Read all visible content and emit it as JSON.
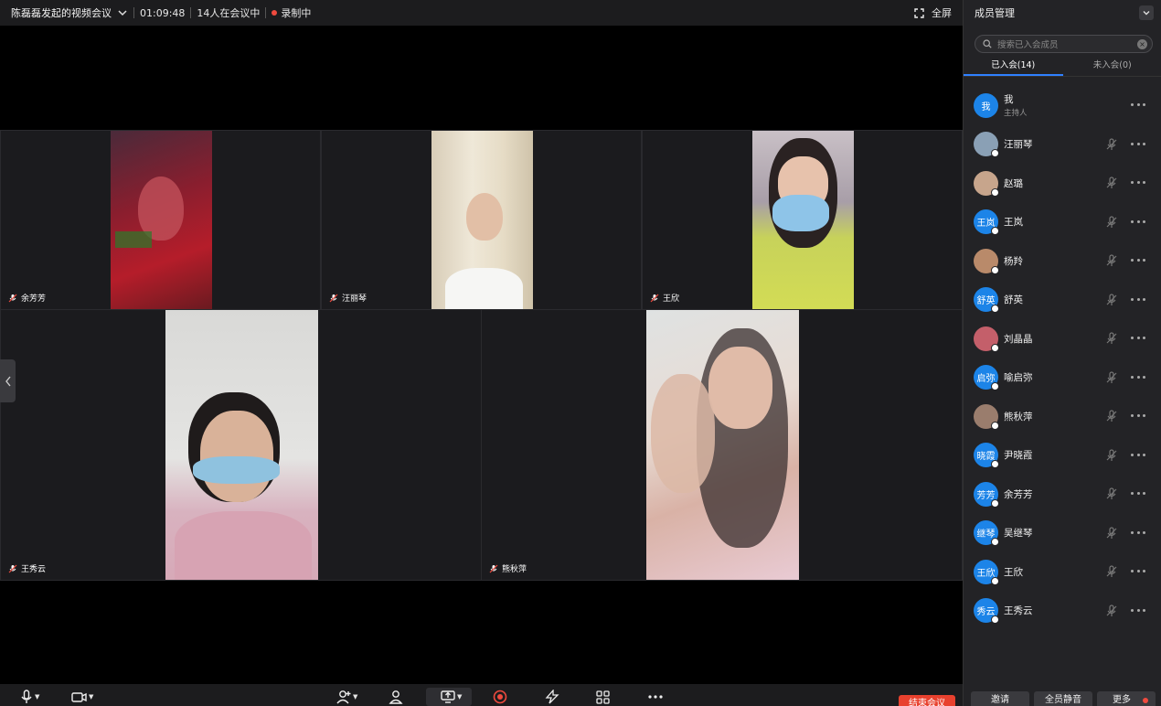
{
  "topbar": {
    "meeting_title": "陈磊磊发起的视频会议",
    "duration": "01:09:48",
    "participants_status": "14人在会议中",
    "recording_status": "录制中",
    "fullscreen_label": "全屏"
  },
  "tiles": [
    {
      "name": "余芳芳"
    },
    {
      "name": "汪丽琴"
    },
    {
      "name": "王欣"
    },
    {
      "name": "王秀云"
    },
    {
      "name": "熊秋萍"
    }
  ],
  "toolbar": {
    "end_meeting_label": "结束会议"
  },
  "panel": {
    "title": "成员管理",
    "search_placeholder": "搜索已入会成员",
    "tab_joined": "已入会(14)",
    "tab_not_joined": "未入会(0)",
    "members": [
      {
        "avatar_text": "我",
        "name": "我",
        "role": "主持人",
        "avatar_color": "#1c84e8"
      },
      {
        "avatar_text": "",
        "name": "汪丽琴",
        "role": "",
        "avatar_color": "#8aa0b5"
      },
      {
        "avatar_text": "",
        "name": "赵璐",
        "role": "",
        "avatar_color": "#c7a58c"
      },
      {
        "avatar_text": "王岚",
        "name": "王岚",
        "role": "",
        "avatar_color": "#1c84e8"
      },
      {
        "avatar_text": "",
        "name": "杨羚",
        "role": "",
        "avatar_color": "#b98a6a"
      },
      {
        "avatar_text": "舒英",
        "name": "舒英",
        "role": "",
        "avatar_color": "#1c84e8"
      },
      {
        "avatar_text": "",
        "name": "刘晶晶",
        "role": "",
        "avatar_color": "#c45f6a"
      },
      {
        "avatar_text": "启弥",
        "name": "喻启弥",
        "role": "",
        "avatar_color": "#1c84e8"
      },
      {
        "avatar_text": "",
        "name": "熊秋萍",
        "role": "",
        "avatar_color": "#9a7d6d"
      },
      {
        "avatar_text": "晓霞",
        "name": "尹晓霞",
        "role": "",
        "avatar_color": "#1c84e8"
      },
      {
        "avatar_text": "芳芳",
        "name": "余芳芳",
        "role": "",
        "avatar_color": "#1c84e8"
      },
      {
        "avatar_text": "继琴",
        "name": "吴继琴",
        "role": "",
        "avatar_color": "#1c84e8"
      },
      {
        "avatar_text": "王欣",
        "name": "王欣",
        "role": "",
        "avatar_color": "#1c84e8"
      },
      {
        "avatar_text": "秀云",
        "name": "王秀云",
        "role": "",
        "avatar_color": "#1c84e8"
      }
    ],
    "invite_label": "邀请",
    "mute_all_label": "全员静音",
    "more_label": "更多"
  },
  "colors": {
    "accent": "#1c84e8",
    "end_button": "#e8412e",
    "recording_dot": "#f04a3e"
  }
}
